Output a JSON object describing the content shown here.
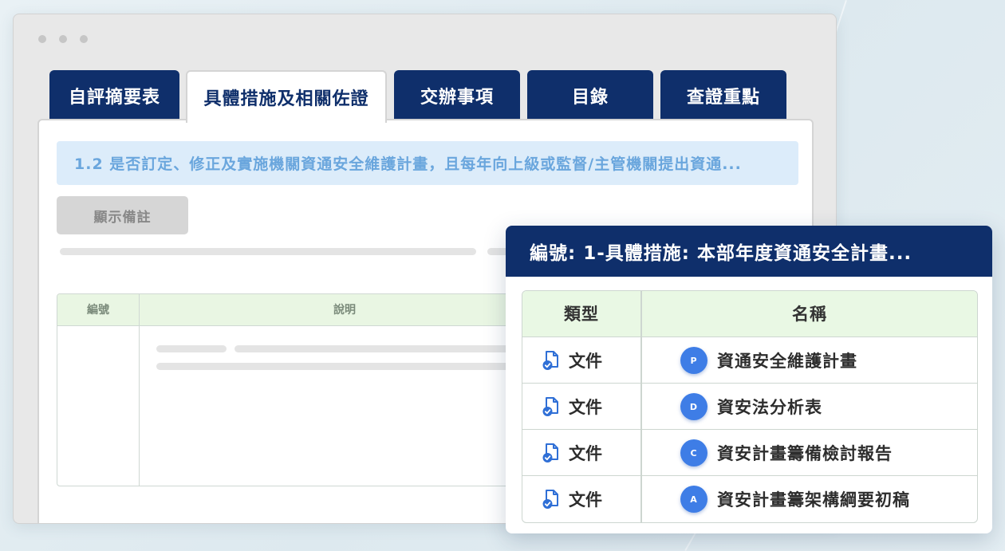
{
  "tabs": [
    {
      "label": "自評摘要表",
      "active": false
    },
    {
      "label": "具體措施及相關佐證",
      "active": true
    },
    {
      "label": "交辦事項",
      "active": false
    },
    {
      "label": "目錄",
      "active": false
    },
    {
      "label": "查證重點",
      "active": false
    }
  ],
  "main": {
    "question": "1.2 是否訂定、修正及實施機關資通安全維護計畫，且每年向上級或監督/主管機關提出資通...",
    "note_button": "顯示備註",
    "table_headers": {
      "number": "編號",
      "description": "說明"
    }
  },
  "popup": {
    "title": "編號: 1-具體措施: 本部年度資通安全計畫...",
    "headers": {
      "type": "類型",
      "name": "名稱"
    },
    "rows": [
      {
        "type": "文件",
        "badge": "P",
        "name": "資通安全維護計畫"
      },
      {
        "type": "文件",
        "badge": "D",
        "name": "資安法分析表"
      },
      {
        "type": "文件",
        "badge": "C",
        "name": "資安計畫籌備檢討報告"
      },
      {
        "type": "文件",
        "badge": "A",
        "name": "資安計畫籌架構綱要初稿"
      }
    ]
  },
  "colors": {
    "navy": "#0f2f6b",
    "question_bg": "#dcecfa",
    "question_text": "#6aa6dd",
    "table_header_bg": "#e9f8e4",
    "badge": "#3e7de6"
  },
  "icons": {
    "document": "document-check-icon"
  }
}
